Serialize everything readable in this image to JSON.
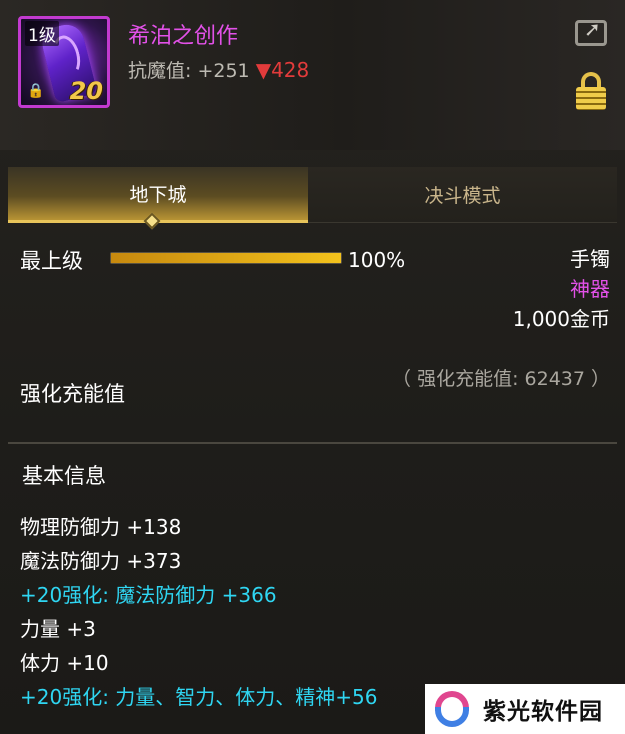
{
  "item": {
    "level_badge": "1级",
    "plus_level": "20",
    "name": "希泊之创作",
    "stat_label": "抗魔值: +251",
    "stat_down": "▼428"
  },
  "tabs": [
    {
      "label": "地下城",
      "active": true
    },
    {
      "label": "决斗模式",
      "active": false
    }
  ],
  "level_row": {
    "label": "最上级",
    "progress": 1.0,
    "percent_text": "100%"
  },
  "item_type": "手镯",
  "rarity": "神器",
  "price": "1,000金币",
  "charge": {
    "label": "强化充能值",
    "value_text": "（ 强化充能值: 62437 ）"
  },
  "basic_info": {
    "title": "基本信息",
    "lines": [
      {
        "text": "物理防御力 +138",
        "highlight": false
      },
      {
        "text": "魔法防御力 +373",
        "highlight": false
      },
      {
        "text": "+20强化: 魔法防御力 +366",
        "highlight": true
      },
      {
        "text": "力量 +3",
        "highlight": false
      },
      {
        "text": "体力 +10",
        "highlight": false
      },
      {
        "text": "+20强化: 力量、智力、体力、精神+56",
        "highlight": true
      }
    ]
  },
  "watermark": {
    "text": "紫光软件园"
  },
  "colors": {
    "name_purple": "#e251e8",
    "stat_red": "#e23b3b",
    "enhance_cyan": "#2fd6f2",
    "bar_gold": "#f3c21c"
  },
  "icons": [
    "share-icon",
    "lock-icon",
    "item-lock-icon",
    "tab-diamond-icon"
  ]
}
